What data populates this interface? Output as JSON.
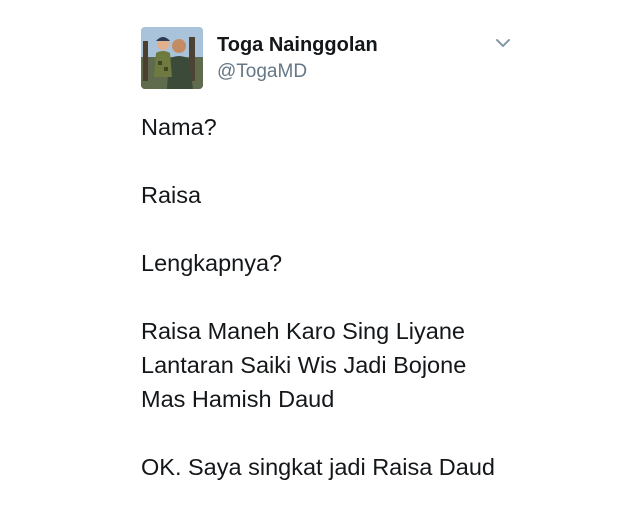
{
  "tweet": {
    "author": {
      "display_name": "Toga Nainggolan",
      "handle": "@TogaMD"
    },
    "menu_icon": "chevron-down-icon",
    "paragraphs": [
      {
        "lines": [
          "Nama?"
        ]
      },
      {
        "lines": [
          "Raisa"
        ]
      },
      {
        "lines": [
          "Lengkapnya?"
        ]
      },
      {
        "lines": [
          "Raisa Maneh Karo Sing Liyane",
          "Lantaran Saiki Wis Jadi Bojone",
          "Mas Hamish Daud"
        ]
      },
      {
        "lines": [
          "OK. Saya singkat jadi Raisa Daud"
        ]
      }
    ]
  },
  "colors": {
    "text": "#14171a",
    "secondary": "#657786",
    "caret": "#8899a6"
  }
}
